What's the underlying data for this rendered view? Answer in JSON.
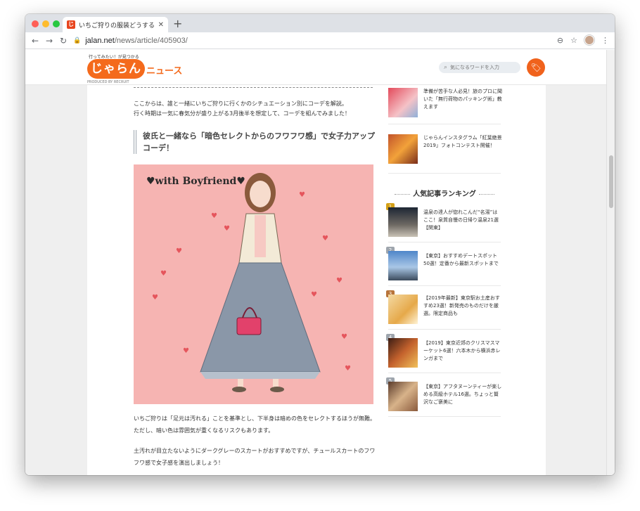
{
  "browser": {
    "tab_title": "いちご狩りの服装どうする？靴・持",
    "tab_favicon_letter": "じ",
    "new_tab": "+",
    "url_host": "jalan.net",
    "url_path": "/news/article/405903/"
  },
  "header": {
    "logo_tagline": "行ってみたい！が見つかる",
    "logo_main": "じゃらん",
    "logo_sub": "ニュース",
    "logo_by": "PRODUCED BY RECRUIT",
    "search_placeholder": "気になるワードを入力"
  },
  "article": {
    "intro_1": "ここからは、誰と一緒にいちご狩りに行くかのシチュエーション別にコーデを解説。",
    "intro_2": "行く時期は一気に春気分が盛り上がる3月後半を想定して、コーデを組んでみました！",
    "heading": "彼氏と一緒なら「暗色セレクトからのフワフワ感」で女子力アップコーデ！",
    "illustration_label": "♥with Boyfriend♥",
    "para_1": "いちご狩りは「足元は汚れる」ことを基準とし、下半身は暗めの色をセレクトするほうが無難。ただし、暗い色は雰囲気が重くなるリスクもあります。",
    "para_2": "土汚れが目立たないようにダークグレーのスカートがおすすめですが、チュールスカートのフワフワ感で女子感を演出しましょう！"
  },
  "sidebar": {
    "related": [
      {
        "text": "準備が苦手な人必見！旅のプロに聞いた「無行荷物のパッキング術」教えます"
      },
      {
        "text": "じゃらんインスタグラム「紅葉絶景2019」フォトコンテスト開催！"
      }
    ],
    "ranking_title": "人気記事ランキング",
    "ranking": [
      {
        "rank": "1",
        "text": "温泉の達人が惚れこんだ“名湯”はここ！泉質自慢の日帰り温泉21選【関東】"
      },
      {
        "rank": "2",
        "text": "【東京】おすすめデートスポット50選！定番から最新スポットまで"
      },
      {
        "rank": "3",
        "text": "【2019年最新】東京駅お土産おすすめ23選！新発売のものだけを厳選。限定商品も"
      },
      {
        "rank": "4",
        "text": "【2019】東京近郊のクリスマスマーケット6選！六本木から横浜赤レンガまで"
      },
      {
        "rank": "5",
        "text": "【東京】アフタヌーンティーが楽しめる高級ホテル16選。ちょっと贅沢なご褒美に"
      }
    ]
  },
  "colors": {
    "brand_orange": "#f46a1c",
    "illustration_bg": "#f6b4b2"
  }
}
